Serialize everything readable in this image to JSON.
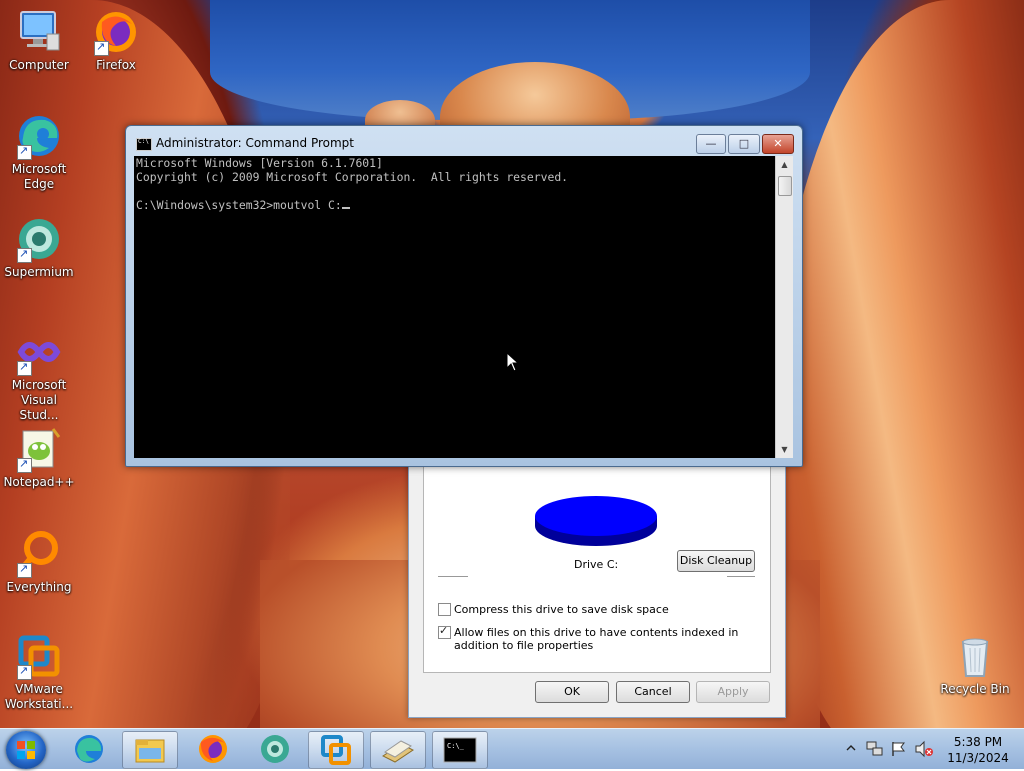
{
  "desktop": {
    "icons": [
      {
        "label": "Computer",
        "icon": "computer-icon"
      },
      {
        "label": "Firefox",
        "icon": "firefox-icon"
      },
      {
        "label": "Microsoft Edge",
        "icon": "edge-icon"
      },
      {
        "label": "Supermium",
        "icon": "supermium-icon"
      },
      {
        "label": "Microsoft Visual Stud...",
        "icon": "visual-studio-icon"
      },
      {
        "label": "Notepad++",
        "icon": "notepadpp-icon"
      },
      {
        "label": "Everything",
        "icon": "everything-icon"
      },
      {
        "label": "VMware Workstati...",
        "icon": "vmware-icon"
      },
      {
        "label": "Recycle Bin",
        "icon": "recycle-bin-icon"
      }
    ]
  },
  "cmd": {
    "title": "Administrator: Command Prompt",
    "lines": [
      "Microsoft Windows [Version 6.1.7601]",
      "Copyright (c) 2009 Microsoft Corporation.  All rights reserved.",
      "",
      "C:\\Windows\\system32>moutvol C:"
    ],
    "controls": {
      "minimize": "—",
      "maximize": "□",
      "close": "✕"
    }
  },
  "properties": {
    "drive_label": "Drive C:",
    "disk_cleanup": "Disk Cleanup",
    "compress_label": "Compress this drive to save disk space",
    "compress_checked": false,
    "index_label": "Allow files on this drive to have contents indexed in addition to file properties",
    "index_checked": true,
    "ok": "OK",
    "cancel": "Cancel",
    "apply": "Apply",
    "pie_color": "#0000ff"
  },
  "taskbar": {
    "time": "5:38 PM",
    "date": "11/3/2024",
    "pinned": [
      "edge-icon",
      "file-explorer-icon",
      "firefox-icon",
      "supermium-icon",
      "vmware-icon",
      "file-manager-icon",
      "command-prompt-icon"
    ]
  }
}
